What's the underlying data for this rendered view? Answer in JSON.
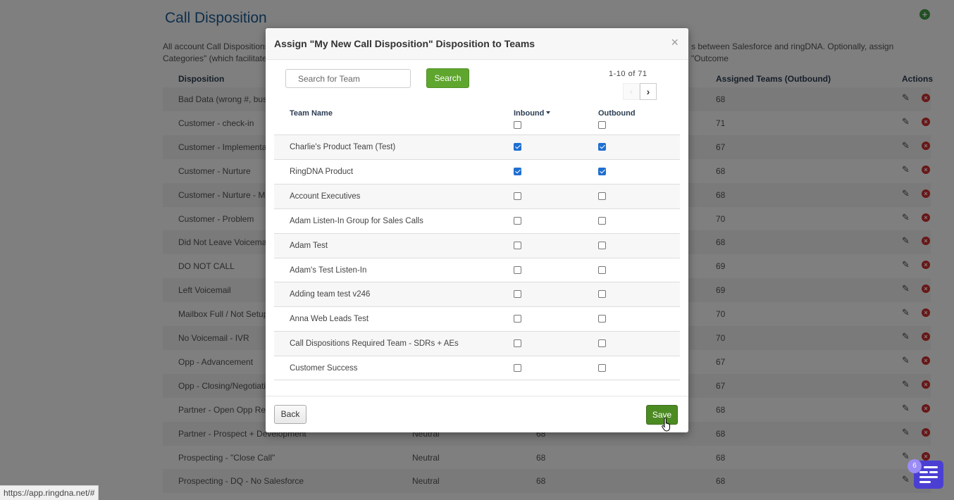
{
  "page": {
    "title": "Call Disposition",
    "description": "All account Call Dispositions a... s between Salesforce and ringDNA. Optionally, assign \"Outcome Categories\" (which facilitate re...",
    "desc_left": "All account Call Dispositions a",
    "desc_right": "s between Salesforce and ringDNA. Optionally, assign \"Outcome",
    "desc_line2": "Categories\" (which facilitate re",
    "columns": {
      "disposition": "Disposition",
      "assigned_outbound": "Assigned Teams (Outbound)",
      "actions": "Actions"
    },
    "rows": [
      {
        "name": "Bad Data (wrong #, busy)",
        "category": "",
        "inbound": "",
        "outbound": "68"
      },
      {
        "name": "Customer - check-in",
        "category": "",
        "inbound": "",
        "outbound": "71"
      },
      {
        "name": "Customer - Implementati",
        "category": "",
        "inbound": "",
        "outbound": "67"
      },
      {
        "name": "Customer - Nurture",
        "category": "",
        "inbound": "",
        "outbound": "68"
      },
      {
        "name": "Customer - Nurture - Mee",
        "category": "",
        "inbound": "",
        "outbound": "68"
      },
      {
        "name": "Customer - Problem",
        "category": "",
        "inbound": "",
        "outbound": "70"
      },
      {
        "name": "Did Not Leave Voicemail",
        "category": "",
        "inbound": "",
        "outbound": "68"
      },
      {
        "name": "DO NOT CALL",
        "category": "",
        "inbound": "",
        "outbound": "69"
      },
      {
        "name": "Left Voicemail",
        "category": "",
        "inbound": "",
        "outbound": "69"
      },
      {
        "name": "Mailbox Full / Not Setup Y",
        "category": "",
        "inbound": "",
        "outbound": "70"
      },
      {
        "name": "No Voicemail - IVR",
        "category": "",
        "inbound": "",
        "outbound": "70"
      },
      {
        "name": "Opp - Advancement",
        "category": "",
        "inbound": "",
        "outbound": "67"
      },
      {
        "name": "Opp - Closing/Negotiatio",
        "category": "",
        "inbound": "",
        "outbound": "67"
      },
      {
        "name": "Partner - Open Opp Revie",
        "category": "",
        "inbound": "",
        "outbound": "68"
      },
      {
        "name": "Partner - Prospect + Development",
        "category": "Neutral",
        "inbound": "68",
        "outbound": "68"
      },
      {
        "name": "Prospecting - \"Close Call\"",
        "category": "Neutral",
        "inbound": "68",
        "outbound": "68"
      },
      {
        "name": "Prospecting - DQ - No Salesforce",
        "category": "Neutral",
        "inbound": "68",
        "outbound": "68"
      }
    ]
  },
  "modal": {
    "title": "Assign \"My New Call Disposition\" Disposition to Teams",
    "close": "×",
    "search_placeholder": "Search for Team",
    "search_button": "Search",
    "paging": "1-10 of 71",
    "prev_icon": "‹",
    "next_icon": "›",
    "headers": {
      "team_name": "Team Name",
      "inbound": "Inbound",
      "outbound": "Outbound"
    },
    "teams": [
      {
        "name": "Charlie's Product Team (Test)",
        "inbound": true,
        "outbound": true
      },
      {
        "name": "RingDNA Product",
        "inbound": true,
        "outbound": true
      },
      {
        "name": "Account Executives",
        "inbound": false,
        "outbound": false
      },
      {
        "name": "Adam Listen-In Group for Sales Calls",
        "inbound": false,
        "outbound": false
      },
      {
        "name": "Adam Test",
        "inbound": false,
        "outbound": false
      },
      {
        "name": "Adam's Test Listen-In",
        "inbound": false,
        "outbound": false
      },
      {
        "name": "Adding team test v246",
        "inbound": false,
        "outbound": false
      },
      {
        "name": "Anna Web Leads Test",
        "inbound": false,
        "outbound": false
      },
      {
        "name": "Call Dispositions Required Team - SDRs + AEs",
        "inbound": false,
        "outbound": false
      },
      {
        "name": "Customer Success",
        "inbound": false,
        "outbound": false
      }
    ],
    "back_button": "Back",
    "save_button": "Save"
  },
  "status_url": "https://app.ringdna.net/#",
  "chat_badge": "6",
  "colors": {
    "accent_green": "#5fa62e",
    "save_green": "#4c8b22",
    "title_blue": "#1d5d99",
    "checkbox_blue": "#1f6fd1",
    "delete_red": "#d32f2f",
    "chat_purple": "#4b3fd3"
  }
}
